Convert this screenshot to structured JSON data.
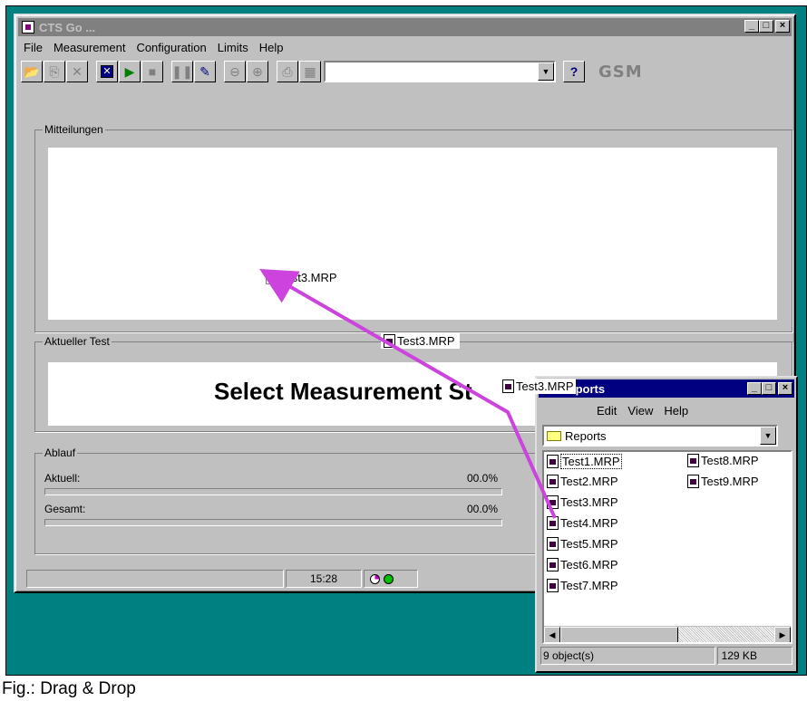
{
  "main_window": {
    "title": "CTS Go ...",
    "menu": [
      "File",
      "Measurement",
      "Configuration",
      "Limits",
      "Help"
    ],
    "toolbar_logo": "GSM"
  },
  "groups": {
    "mitteilungen": "Mitteilungen",
    "aktueller_test": "Aktueller Test",
    "ablauf": "Ablauf"
  },
  "current_test_text": "Select Measurement St",
  "progress": {
    "aktuell_label": "Aktuell:",
    "aktuell_value": "00.0%",
    "gesamt_label": "Gesamt:",
    "gesamt_value": "00.0%"
  },
  "statusbar": {
    "time": "15:28"
  },
  "drag_labels": {
    "drop_target": "Test3.MRP",
    "in_transit": "Test3.MRP",
    "near_window": "Test3.MRP"
  },
  "reports_window": {
    "title": "Reports",
    "menu": [
      "Edit",
      "View",
      "Help"
    ],
    "folder": "Reports",
    "files_col1": [
      "Test1.MRP",
      "Test2.MRP",
      "Test3.MRP",
      "Test4.MRP",
      "Test5.MRP",
      "Test6.MRP",
      "Test7.MRP"
    ],
    "files_col2": [
      "Test8.MRP",
      "Test9.MRP"
    ],
    "status_objects": "9 object(s)",
    "status_size": "129 KB"
  },
  "caption": "Fig.: Drag & Drop",
  "colors": {
    "desktop": "#008080",
    "active_title": "#000080",
    "inactive_title": "#808080",
    "drag_arrow": "#cc44dd"
  }
}
